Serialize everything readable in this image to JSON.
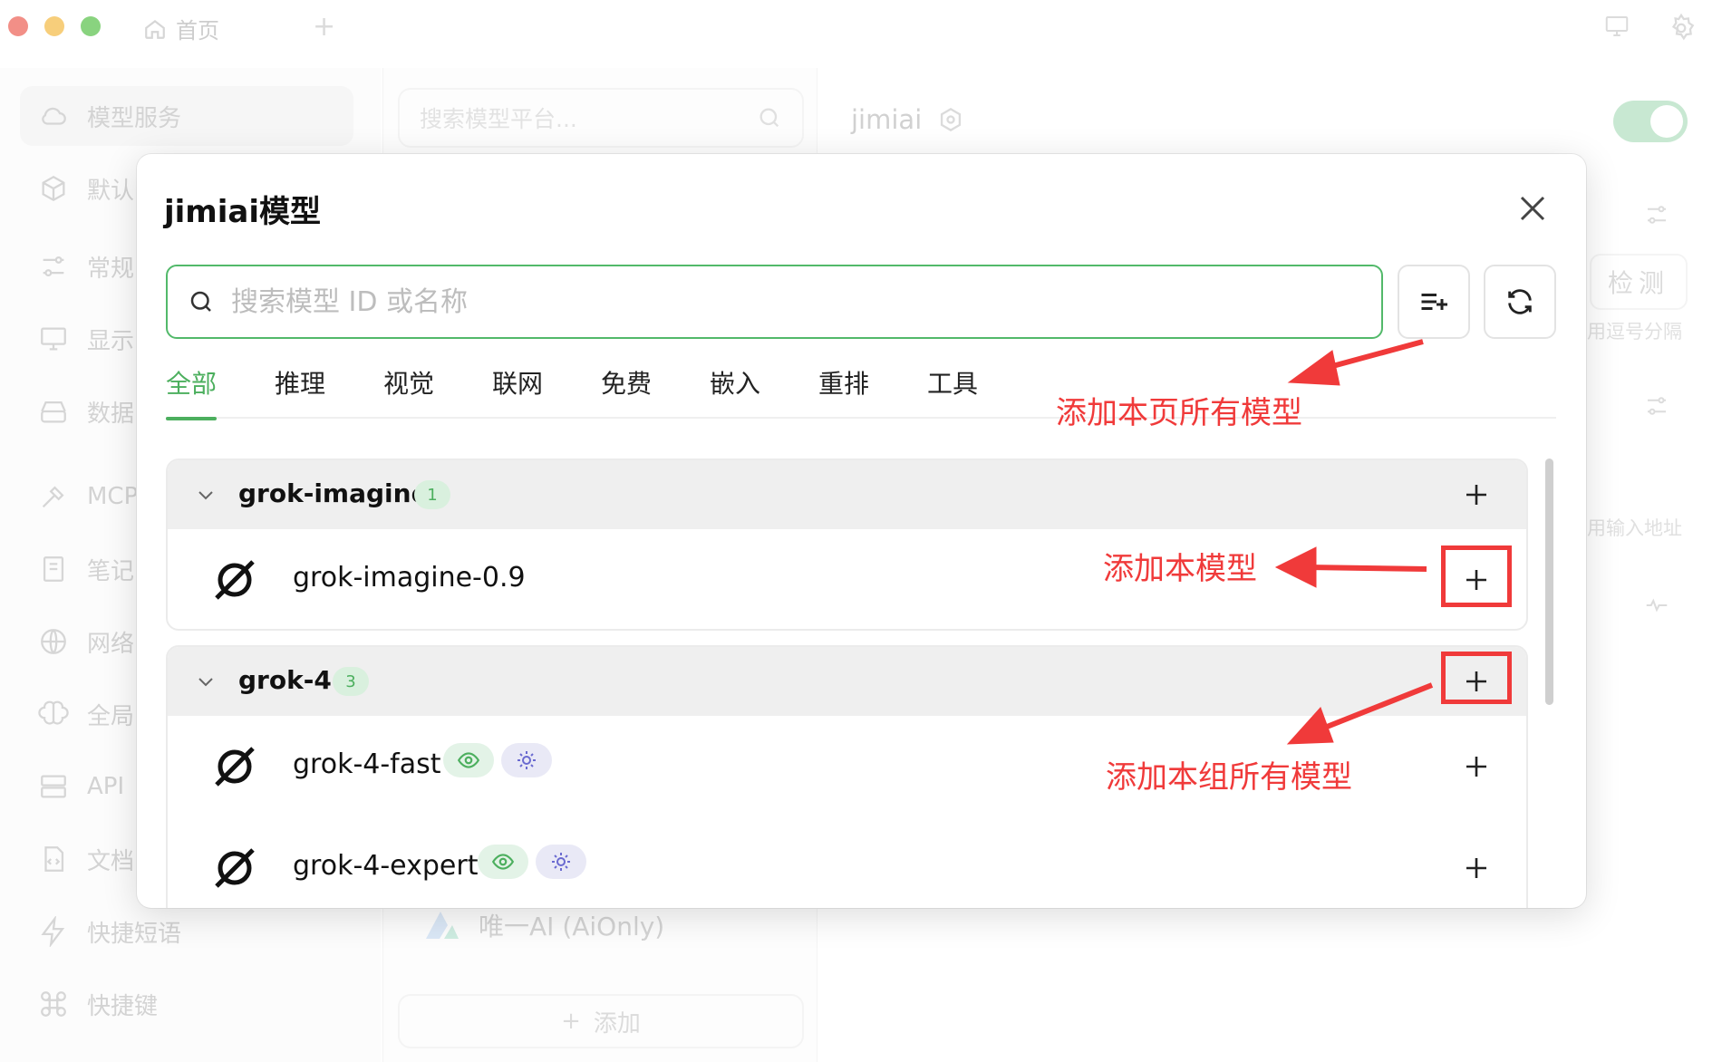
{
  "titlebar": {
    "home_tab": "首页"
  },
  "sidebar": {
    "items": [
      {
        "label": "模型服务"
      },
      {
        "label": "默认"
      },
      {
        "label": "常规"
      },
      {
        "label": "显示"
      },
      {
        "label": "数据"
      },
      {
        "label": "MCP"
      },
      {
        "label": "笔记"
      },
      {
        "label": "网络"
      },
      {
        "label": "全局"
      },
      {
        "label": "API"
      },
      {
        "label": "文档"
      },
      {
        "label": "快捷短语"
      },
      {
        "label": "快捷键"
      }
    ]
  },
  "middle": {
    "search_placeholder": "搜索模型平台...",
    "provider_name": "唯一AI (AiOnly)",
    "add_label": "添加"
  },
  "right": {
    "provider_title": "jimiai",
    "check_label": "检测",
    "hint_comma": "用逗号分隔",
    "hint_input": "用输入地址"
  },
  "dialog": {
    "title": "jimiai模型",
    "search_placeholder": "搜索模型 ID 或名称",
    "tabs": [
      {
        "label": "全部"
      },
      {
        "label": "推理"
      },
      {
        "label": "视觉"
      },
      {
        "label": "联网"
      },
      {
        "label": "免费"
      },
      {
        "label": "嵌入"
      },
      {
        "label": "重排"
      },
      {
        "label": "工具"
      }
    ],
    "active_tab": "全部",
    "groups": [
      {
        "name": "grok-imagine",
        "count": "1",
        "models": [
          {
            "name": "grok-imagine-0.9",
            "capabilities": []
          }
        ]
      },
      {
        "name": "grok-4",
        "count": "3",
        "models": [
          {
            "name": "grok-4-fast",
            "capabilities": [
              "eye-icon",
              "bulb-icon"
            ]
          },
          {
            "name": "grok-4-expert",
            "capabilities": [
              "eye-icon",
              "bulb-icon"
            ]
          }
        ]
      }
    ]
  },
  "annotations": {
    "add_page_all": "添加本页所有模型",
    "add_this": "添加本模型",
    "add_group_all": "添加本组所有模型",
    "color": "#f03a3a"
  },
  "colors": {
    "accent": "#4caf5e",
    "annotation": "#f03a3a"
  }
}
